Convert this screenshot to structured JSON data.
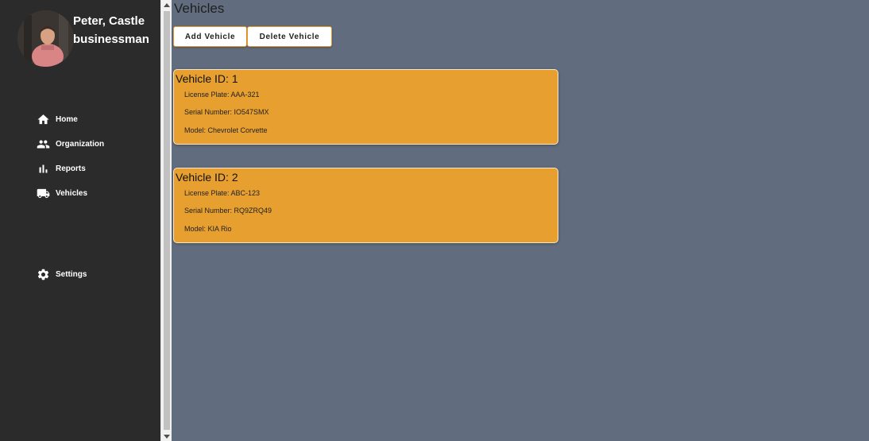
{
  "user": {
    "name": "Peter, Castle",
    "role": "businessman"
  },
  "nav": {
    "items": [
      {
        "label": "Home",
        "icon": "home-icon"
      },
      {
        "label": "Organization",
        "icon": "people-icon"
      },
      {
        "label": "Reports",
        "icon": "bar-chart-icon"
      },
      {
        "label": "Vehicles",
        "icon": "truck-icon"
      },
      {
        "label": "Settings",
        "icon": "gear-icon"
      }
    ]
  },
  "page": {
    "title": "Vehicles",
    "add_button": "Add Vehicle",
    "delete_button": "Delete Vehicle"
  },
  "vehicles": [
    {
      "title": "Vehicle ID: 1",
      "license": "License Plate: AAA-321",
      "serial": "Serial Number: IO547SMX",
      "model": "Model: Chevrolet Corvette"
    },
    {
      "title": "Vehicle ID: 2",
      "license": "License Plate: ABC-123",
      "serial": "Serial Number: RQ9ZRQ49",
      "model": "Model: KIA Rio"
    }
  ],
  "colors": {
    "sidebar": "#2b2b2b",
    "background": "#616d7e",
    "card": "#e79f2f",
    "accent": "#e39a2d"
  }
}
